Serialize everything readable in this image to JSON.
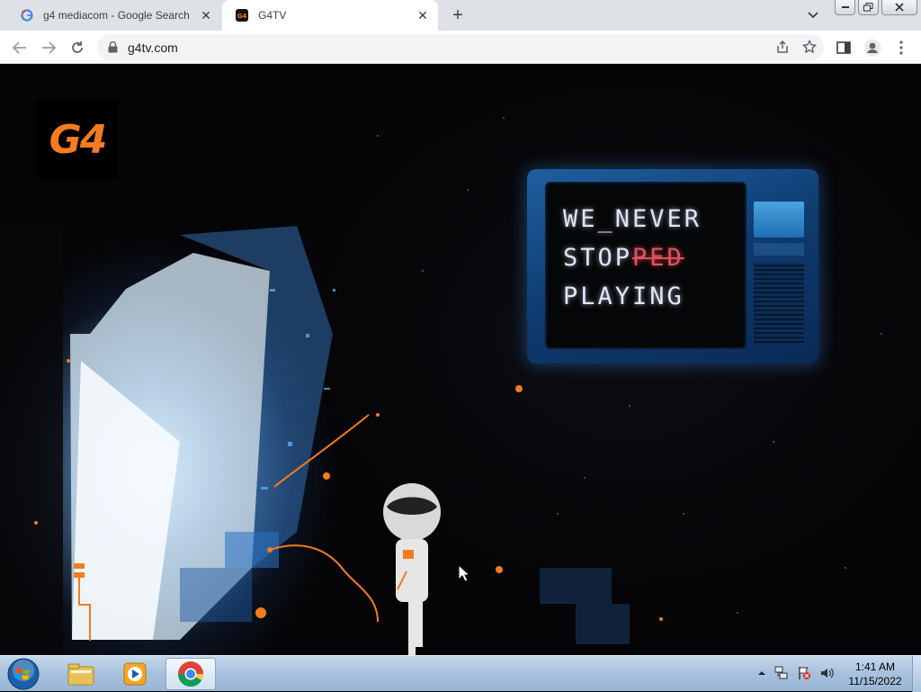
{
  "browser": {
    "tabs": [
      {
        "title": "g4 mediacom - Google Search",
        "icon": "google-icon",
        "active": false
      },
      {
        "title": "G4TV",
        "icon": "g4tv-icon",
        "active": true
      }
    ],
    "url": "g4tv.com"
  },
  "page": {
    "logo_text": "G4",
    "tv_lines": {
      "line1": "WE_NEVER",
      "line2_main": "STOP",
      "line2_struck": "PED",
      "line3": "PLAYING"
    },
    "accent_color": "#f47b20",
    "tv_color": "#1f5fa0"
  },
  "taskbar": {
    "apps": [
      "start-orb-icon",
      "file-explorer-icon",
      "media-player-icon",
      "chrome-icon"
    ],
    "clock_time": "1:41 AM",
    "clock_date": "11/15/2022"
  }
}
